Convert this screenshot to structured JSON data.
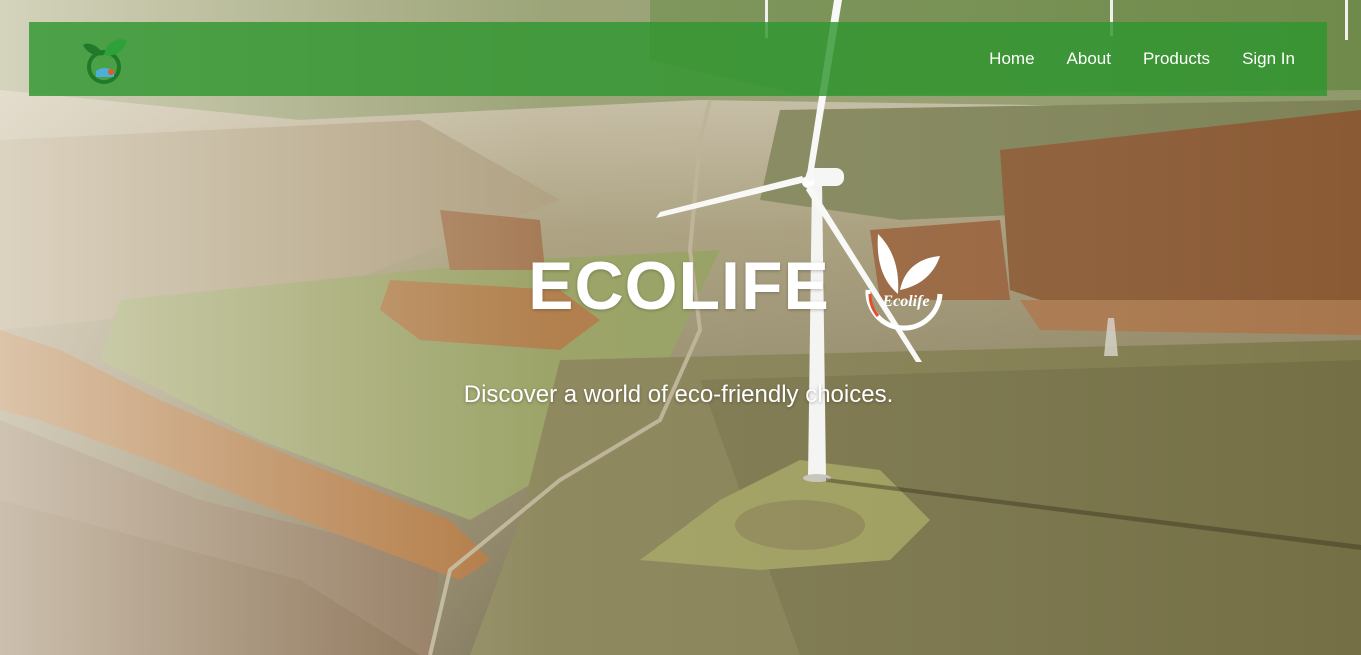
{
  "navbar": {
    "logo_icon": "ecolife-leaf-logo-icon",
    "links": [
      {
        "label": "Home"
      },
      {
        "label": "About"
      },
      {
        "label": "Products"
      },
      {
        "label": "Sign In"
      }
    ]
  },
  "hero": {
    "title": "ECOLIFE",
    "brand_mark_text": "Ecolife",
    "tagline": "Discover a world of eco-friendly choices."
  },
  "colors": {
    "navbar_green": "#309630",
    "text": "#ffffff"
  }
}
